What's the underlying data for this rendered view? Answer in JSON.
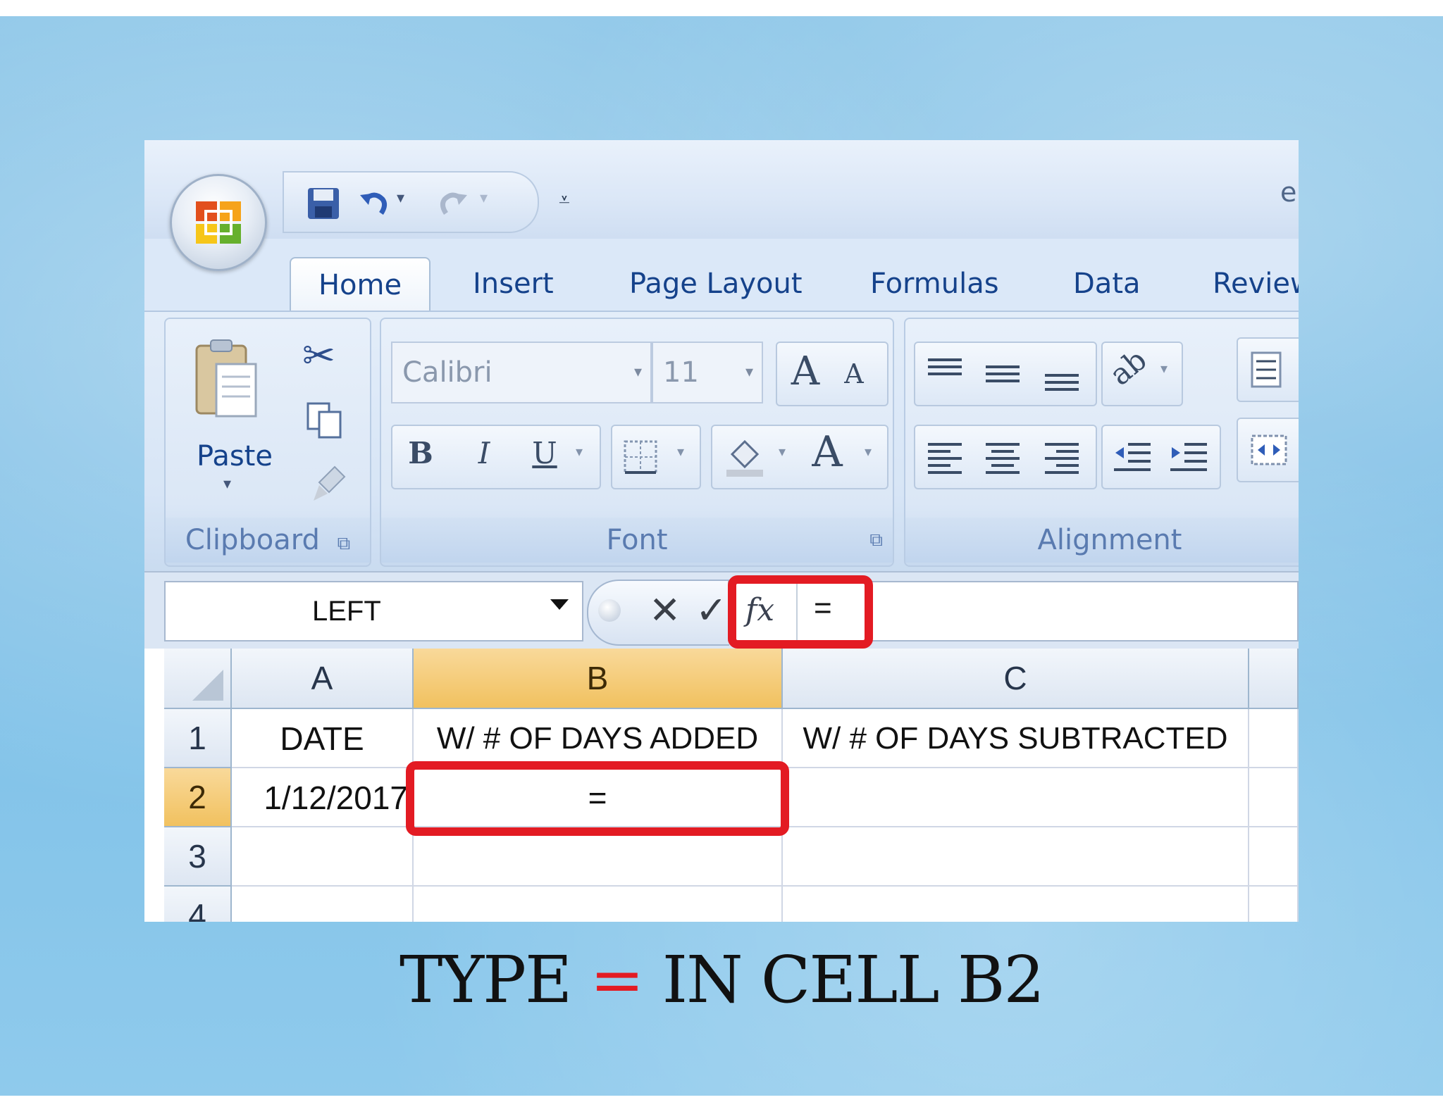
{
  "window": {
    "title_fragment": "e"
  },
  "tabs": [
    {
      "label": "Home",
      "active": true
    },
    {
      "label": "Insert",
      "active": false
    },
    {
      "label": "Page Layout",
      "active": false
    },
    {
      "label": "Formulas",
      "active": false
    },
    {
      "label": "Data",
      "active": false
    },
    {
      "label": "Review",
      "active": false
    }
  ],
  "ribbon": {
    "clipboard": {
      "label": "Clipboard",
      "paste_label": "Paste"
    },
    "font": {
      "label": "Font",
      "font_name": "Calibri",
      "font_size": "11"
    },
    "alignment": {
      "label": "Alignment"
    }
  },
  "formula_bar": {
    "name_box": "LEFT",
    "cancel_glyph": "✕",
    "enter_glyph": "✓",
    "fx_label": "fx",
    "value": "="
  },
  "sheet": {
    "columns": [
      "A",
      "B",
      "C"
    ],
    "rows": [
      {
        "num": "1",
        "cells": [
          "DATE",
          "W/ # OF DAYS ADDED",
          "W/ # OF DAYS SUBTRACTED"
        ]
      },
      {
        "num": "2",
        "cells": [
          "1/12/2017",
          "=",
          ""
        ]
      },
      {
        "num": "3",
        "cells": [
          "",
          "",
          ""
        ]
      },
      {
        "num": "4",
        "cells": [
          "",
          "",
          ""
        ]
      }
    ],
    "active_cell": "B2"
  },
  "caption": {
    "pre": "TYPE ",
    "eq": "=",
    "post": " IN CELL B2"
  },
  "colors": {
    "highlight": "#e31b23",
    "selected_header": "#f1c15f",
    "accent_blue": "#15428b"
  }
}
